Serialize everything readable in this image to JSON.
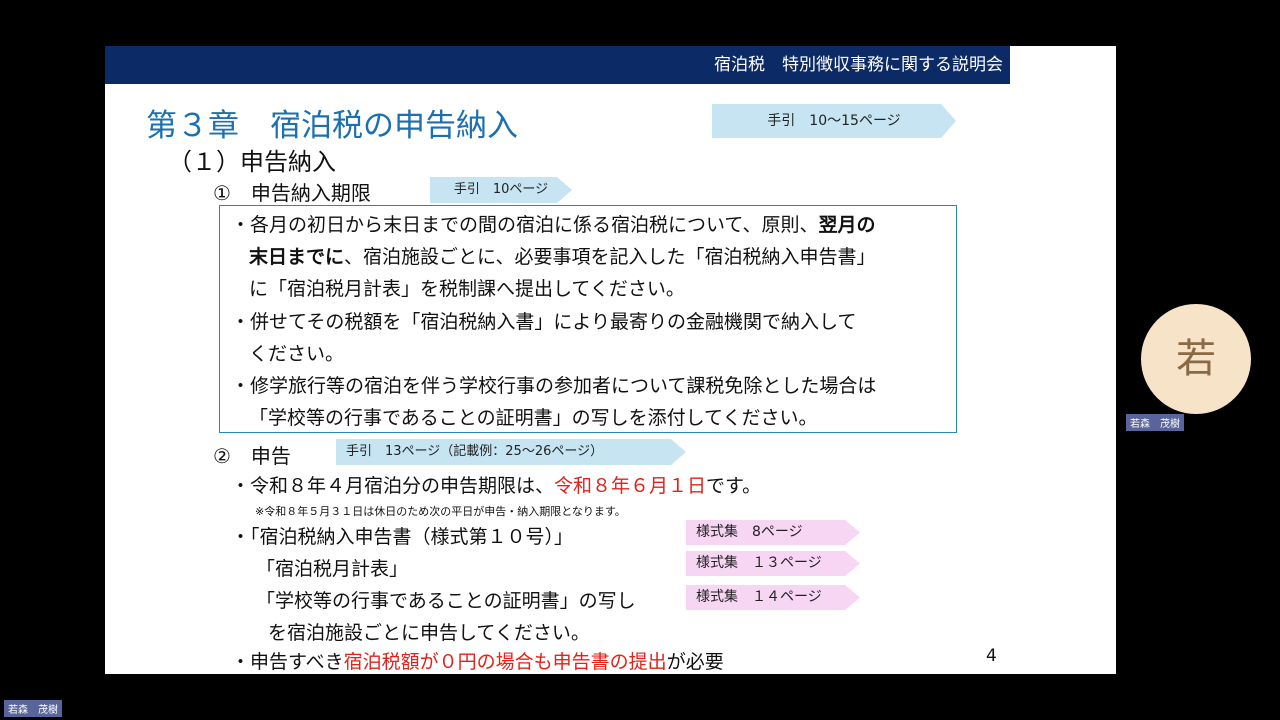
{
  "header": {
    "title": "宿泊税　特別徴収事務に関する説明会"
  },
  "chapter": {
    "title": "第３章　宿泊税の申告納入",
    "guide_tag": "手引　10～15ページ"
  },
  "section": {
    "title": "（１）申告納入"
  },
  "sub1": {
    "title": "①　申告納入期限",
    "guide_tag": "手引　10ページ",
    "lines": [
      {
        "pre": "・各月の初日から末日までの間の宿泊に係る宿泊税について、原則、",
        "bold": "翌月の"
      },
      {
        "bold": "末日までに",
        "post": "、宿泊施設ごとに、必要事項を記入した「宿泊税納入申告書」"
      },
      {
        "text": "に「宿泊税月計表」を税制課へ提出してください。"
      },
      {
        "text": "・併せてその税額を「宿泊税納入書」により最寄りの金融機関で納入して"
      },
      {
        "text": "ください。"
      },
      {
        "text": "・修学旅行等の宿泊を伴う学校行事の参加者について課税免除とした場合は"
      },
      {
        "text": "「学校等の行事であることの証明書」の写しを添付してください。"
      }
    ]
  },
  "sub2": {
    "title": "②　申告",
    "guide_tag": "手引　13ページ（記載例：25～26ページ）",
    "deadline": {
      "pre": "・令和８年４月宿泊分の申告期限は、",
      "red": "令和８年６月１日",
      "post": "です。"
    },
    "note": "※令和８年５月３１日は休日のため次の平日が申告・納入期限となります。",
    "forms": [
      {
        "text": "・「宿泊税納入申告書（様式第１０号）」",
        "tag": "様式集　8ページ"
      },
      {
        "text": "「宿泊税月計表」",
        "tag": "様式集　１３ページ"
      },
      {
        "text": "「学校等の行事であることの証明書」の写し",
        "tag": "様式集　１４ページ"
      }
    ],
    "forms_tail": "を宿泊施設ごとに申告してください。",
    "zero": {
      "pre": "・申告すべき",
      "red": "宿泊税額が０円の場合も申告書の提出",
      "post": "が必要"
    }
  },
  "page_number": "4",
  "participant": {
    "initial": "若",
    "name": "若森　茂樹"
  },
  "self_view": {
    "name": "若森　茂樹"
  },
  "colors": {
    "header": "#0c2a66",
    "title": "#1c6fb0",
    "red": "#e0231b",
    "blue_tag": "#c6e4f2",
    "pink_tag": "#f7d6f4"
  }
}
